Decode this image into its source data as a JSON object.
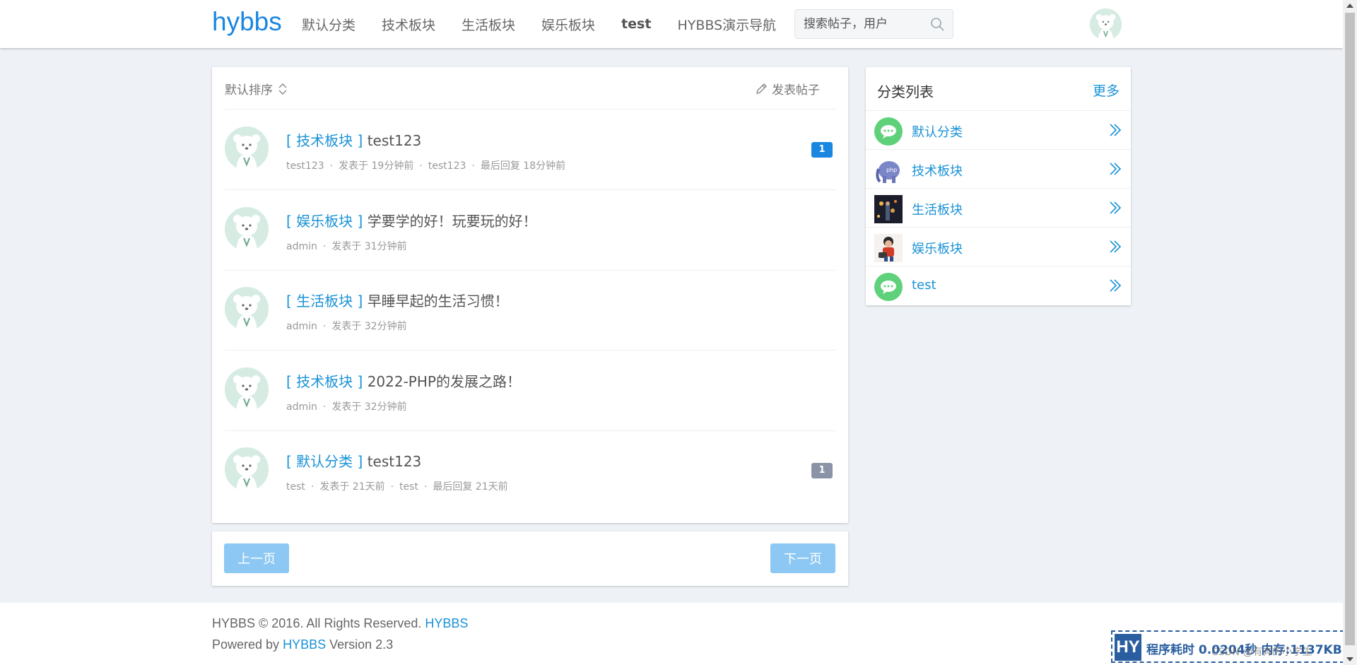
{
  "header": {
    "logo": "hybbs",
    "nav": [
      "默认分类",
      "技术板块",
      "生活板块",
      "娱乐板块",
      "test",
      "HYBBS演示导航"
    ],
    "search_placeholder": "搜索帖子，用户"
  },
  "posts_panel": {
    "sort_label": "默认排序",
    "new_post_label": "发表帖子",
    "posts": [
      {
        "category": "[ 技术板块 ]",
        "title": "test123",
        "meta": [
          "test123",
          "发表于 19分钟前",
          "test123",
          "最后回复 18分钟前"
        ],
        "badge": "1",
        "badge_color": "#1a86e0"
      },
      {
        "category": "[ 娱乐板块 ]",
        "title": "学要学的好！玩要玩的好！",
        "meta": [
          "admin",
          "发表于 31分钟前"
        ],
        "badge": "",
        "badge_color": ""
      },
      {
        "category": "[ 生活板块 ]",
        "title": "早睡早起的生活习惯！",
        "meta": [
          "admin",
          "发表于 32分钟前"
        ],
        "badge": "",
        "badge_color": ""
      },
      {
        "category": "[ 技术板块 ]",
        "title": "2022-PHP的发展之路！",
        "meta": [
          "admin",
          "发表于 32分钟前"
        ],
        "badge": "",
        "badge_color": ""
      },
      {
        "category": "[ 默认分类 ]",
        "title": "test123",
        "meta": [
          "test",
          "发表于 21天前",
          "test",
          "最后回复 21天前"
        ],
        "badge": "1",
        "badge_color": "#8a94a6"
      }
    ]
  },
  "pager": {
    "prev": "上一页",
    "next": "下一页"
  },
  "categories": {
    "title": "分类列表",
    "more": "更多",
    "items": [
      {
        "name": "默认分类",
        "icon": "chat-bubble-icon"
      },
      {
        "name": "技术板块",
        "icon": "php-elephant-icon"
      },
      {
        "name": "生活板块",
        "icon": "life-photo-icon"
      },
      {
        "name": "娱乐板块",
        "icon": "entertainment-photo-icon"
      },
      {
        "name": "test",
        "icon": "chat-bubble-icon"
      }
    ]
  },
  "footer": {
    "copyright": "HYBBS © 2016. All Rights Reserved. ",
    "copyright_link": "HYBBS",
    "powered_prefix": "Powered by ",
    "powered_link": "HYBBS",
    "powered_suffix": " Version 2.3"
  },
  "debug_bar": {
    "logo": "HY",
    "text": "程序耗时 0.0204秒 内存:1137KB",
    "watermark": "CSDN @有奔的小学生"
  },
  "colors": {
    "accent": "#1a86e0",
    "link": "#1a92d6",
    "button": "#8cc8f3"
  }
}
